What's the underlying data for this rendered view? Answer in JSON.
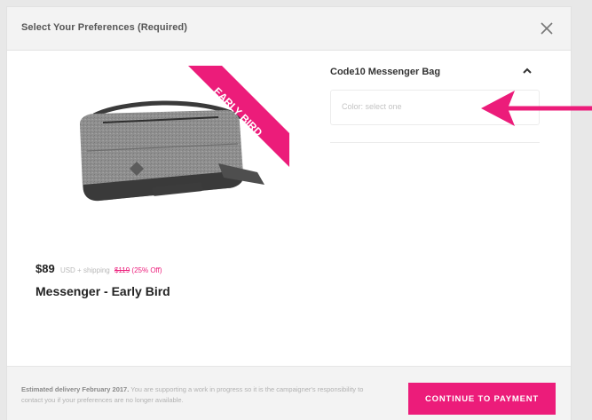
{
  "modal": {
    "title": "Select Your Preferences (Required)",
    "close_icon": "close-icon"
  },
  "product": {
    "image_icon": "messenger-bag-image",
    "ribbon_text": "EARLY BIRD",
    "price": "$89",
    "price_note": "USD + shipping",
    "original_price": "$119",
    "discount": "(25% Off)",
    "title": "Messenger - Early Bird"
  },
  "option": {
    "name": "Code10 Messenger Bag",
    "caret_icon": "chevron-up-icon",
    "color_placeholder": "Color: select one"
  },
  "footer": {
    "delivery_label": "Estimated delivery February 2017.",
    "disclaimer": "You are supporting a work in progress so it is the campaigner's responsibility to contact you if your preferences are no longer available.",
    "continue_label": "CONTINUE TO PAYMENT"
  },
  "annotation": {
    "arrow_icon": "pointer-arrow-icon"
  },
  "colors": {
    "accent": "#ec1c7a",
    "header_bg": "#f3f3f3",
    "background": "#e8e8e8"
  }
}
